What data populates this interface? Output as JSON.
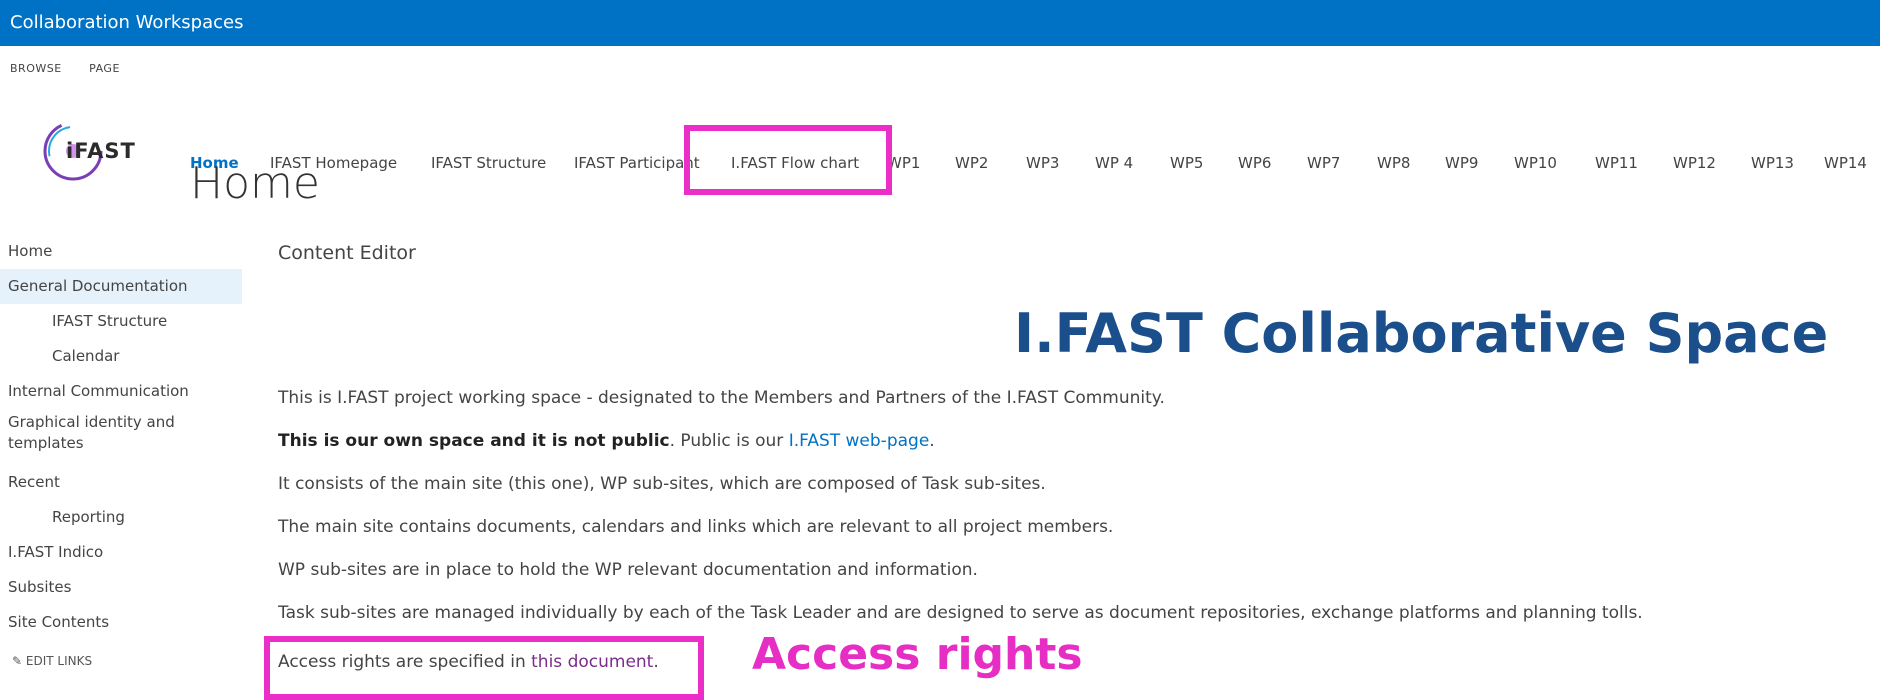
{
  "suitebar": {
    "title": "Collaboration Workspaces"
  },
  "ribbon": {
    "tabs": [
      "BROWSE",
      "PAGE"
    ]
  },
  "logo": {
    "text": "iFAST"
  },
  "topnav": {
    "items": [
      "Home",
      "IFAST Homepage",
      "IFAST Structure",
      "IFAST Participant",
      "I.FAST Flow chart",
      "WP1",
      "WP2",
      "WP3",
      "WP 4",
      "WP5",
      "WP6",
      "WP7",
      "WP8",
      "WP9",
      "WP10",
      "WP11",
      "WP12",
      "WP13",
      "WP14"
    ]
  },
  "page": {
    "title": "Home"
  },
  "left_nav": {
    "items": [
      "Home",
      "General Documentation",
      "IFAST Structure",
      "Calendar",
      "Internal Communication",
      "Graphical identity and templates",
      "Recent",
      "Reporting",
      "I.FAST Indico",
      "Subsites",
      "Site Contents"
    ],
    "edit_links": "EDIT LINKS"
  },
  "content": {
    "label": "Content Editor",
    "heading": "I.FAST Collaborative Space",
    "p1": "This is I.FAST project working space - designated to the Members and Partners of the I.FAST Community.",
    "p2_bold": "This is our own space and it is not public",
    "p2_mid": ". Public is our ",
    "p2_link": "I.FAST web-page",
    "p2_end": ".",
    "p3": "It consists of the main site (this one), WP sub-sites, which are composed of Task sub-sites.",
    "p4": "The main site contains documents, calendars and links which are relevant to all project members.",
    "p5": "WP sub-sites are in place to hold the WP relevant documentation and information.",
    "p6": "Task sub-sites are managed individually by each of the Task Leader and are designed to serve as document repositories, exchange platforms and planning tolls.",
    "p7_start": "Access rights are specified in ",
    "p7_link": "this document",
    "p7_end": "."
  },
  "annotation": {
    "text": "Access rights"
  },
  "colors": {
    "suitebar": "#0072c6",
    "highlight": "#ea2ec7",
    "heading": "#1b4f8b",
    "link": "#0072c6"
  }
}
